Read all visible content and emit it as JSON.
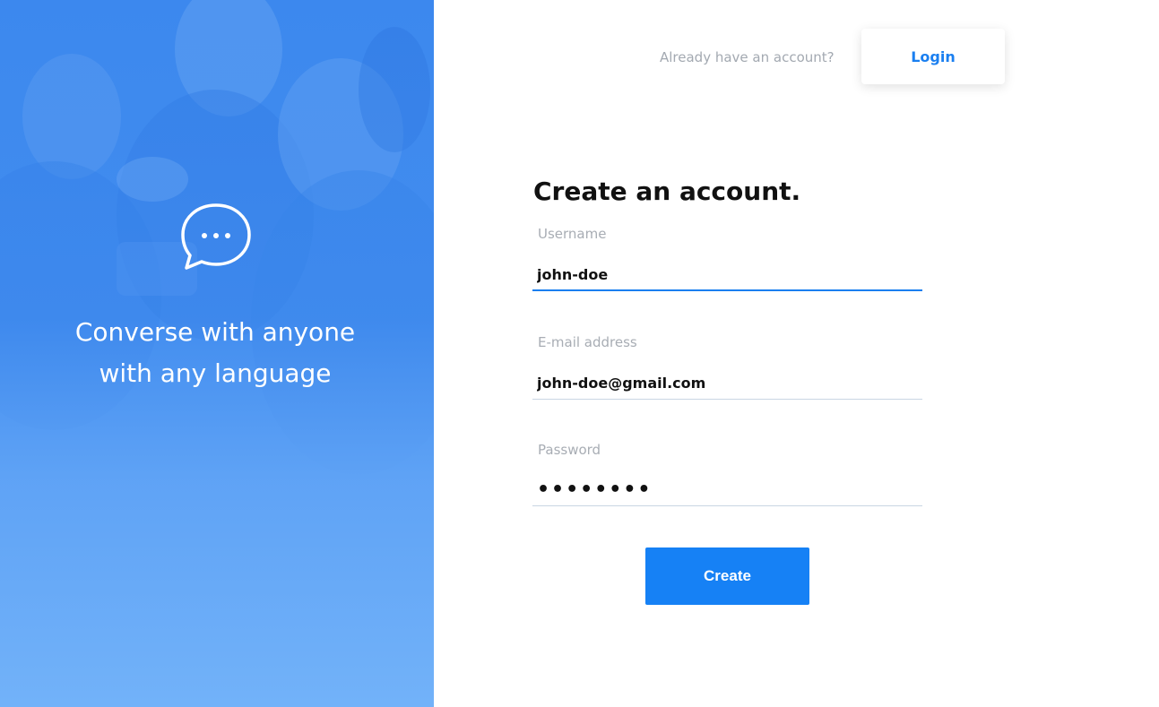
{
  "hero": {
    "tagline_line1": "Converse with anyone",
    "tagline_line2": "with any language",
    "icon": "chat-bubble-icon"
  },
  "header": {
    "prompt": "Already have an account?",
    "login_label": "Login"
  },
  "form": {
    "title": "Create an account.",
    "username": {
      "label": "Username",
      "value": "john-doe"
    },
    "email": {
      "label": "E-mail address",
      "value": "john-doe@gmail.com"
    },
    "password": {
      "label": "Password",
      "value": "••••••••"
    },
    "submit_label": "Create"
  },
  "colors": {
    "accent": "#1681f5",
    "hero_blue": "#4d95f1",
    "label_gray": "#a8adb4"
  }
}
